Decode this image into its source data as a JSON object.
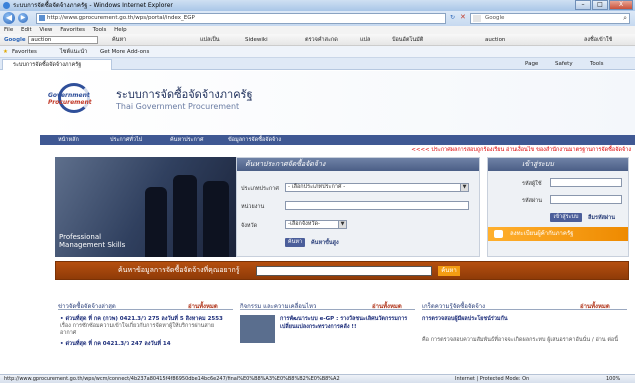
{
  "window": {
    "title": "ระบบการจัดซื้อจัดจ้างภาครัฐ - Windows Internet Explorer",
    "minimize": "–",
    "maximize": "□",
    "close": "X"
  },
  "address": {
    "back": "◀",
    "forward": "▶",
    "url": "http://www.gprocurement.go.th/wps/portal/index_EGP",
    "search_placeholder": "Google"
  },
  "menu": [
    "File",
    "Edit",
    "View",
    "Favorites",
    "Tools",
    "Help"
  ],
  "google_toolbar": {
    "label": "Google",
    "box_value": "auction",
    "items": [
      "ค้นหา",
      "แปลเป็น",
      "Sidewiki",
      "ตรวจคำสะกด",
      "แปล",
      "ป้อนอัตโนมัติ",
      "auction",
      "ลงชื่อเข้าใช้"
    ]
  },
  "favorites": {
    "label": "Favorites",
    "items": [
      "ไซต์แนะนำ",
      "Get More Add-ons"
    ]
  },
  "tab": {
    "label": "ระบบการจัดซื้อจัดจ้างภาครัฐ",
    "tools": [
      "Page",
      "Safety",
      "Tools"
    ]
  },
  "site": {
    "logo_line1": "Government",
    "logo_line2": "Procurement",
    "title": "ระบบการจัดซื้อจัดจ้างภาครัฐ",
    "subtitle": "Thai Government Procurement",
    "nav": [
      "หน้าหลัก",
      "ประกาศทั่วไป",
      "ค้นหาประกาศ",
      "ข้อมูลการจัดซื้อจัดจ้าง"
    ],
    "marquee": "<<<< ประกาศผลการสอบถูกร้องเรียน อ่านเงื่อนไข ของสำนักงานมาตรฐานการจัดซื้อจัดจ้าง"
  },
  "banner": {
    "line1": "Professional",
    "line2": "Management Skills"
  },
  "search_panel": {
    "title": "ค้นหาประกาศจัดซื้อจัดจ้าง",
    "type_label": "ประเภทประกาศ",
    "type_value": "- เลือกประเภทประกาศ -",
    "agency_label": "หน่วยงาน",
    "province_label": "จังหวัด",
    "province_value": "-เลือกจังหวัด-",
    "search_button": "ค้นหา",
    "advanced_link": "ค้นหาขั้นสูง"
  },
  "login_panel": {
    "title": "เข้าสู่ระบบ",
    "user_label": "รหัสผู้ใช้",
    "pass_label": "รหัสผ่าน",
    "login_button": "เข้าสู่ระบบ",
    "forgot_link": "ลืมรหัสผ่าน",
    "register": "ลงทะเบียนผู้ค้ากับภาครัฐ"
  },
  "search_strip": {
    "label": "ค้นหาข้อมูลการจัดซื้อจัดจ้างที่คุณอยากรู้",
    "button": "ค้นหา"
  },
  "columns": [
    {
      "title": "ข่าวจัดซื้อจัดจ้างล่าสุด",
      "all": "อ่านทั้งหมด",
      "headline": "ด่วนที่สุด ที่ กค (กวพ) 0421.3/ว 275 ลงวันที่ 5 สิงหาคม 2553",
      "body": "เรื่อง การซักซ้อมความเข้าใจเกี่ยวกับการจัดหาผู้ให้บริการผ่านสายอากาศ",
      "headline2": "ด่วนที่สุด ที่ กค 0421.3/ว 247 ลงวันที่ 14"
    },
    {
      "title": "กิจกรรม และความเคลื่อนไหว",
      "all": "อ่านทั้งหมด",
      "headline": "การพัฒนาระบบ e-GP : รางวัลชนะเลิศนวัตกรรมการเปลี่ยนแปลงกระทรวงการคลัง !!"
    },
    {
      "title": "เกร็ดความรู้จัดซื้อจัดจ้าง",
      "all": "อ่านทั้งหมด",
      "headline": "การตรวจสอบผู้มีผลประโยชน์ร่วมกัน",
      "body": "คือ การตรวจสอบความสัมพันธ์ที่อาจจะเกิดผลกระทบ ผู้เสนอราคาอันนั่น / อ่าน ต่อนี้"
    }
  ],
  "status": {
    "url": "http://www.gprocurement.go.th/wps/wcm/connect/4b237a80415f4f86950dbe14bc6e247/final%E0%B8%A3%E0%B8%B2%E0%B8%A2",
    "zone": "Internet | Protected Mode: On",
    "zoom": "100%"
  }
}
